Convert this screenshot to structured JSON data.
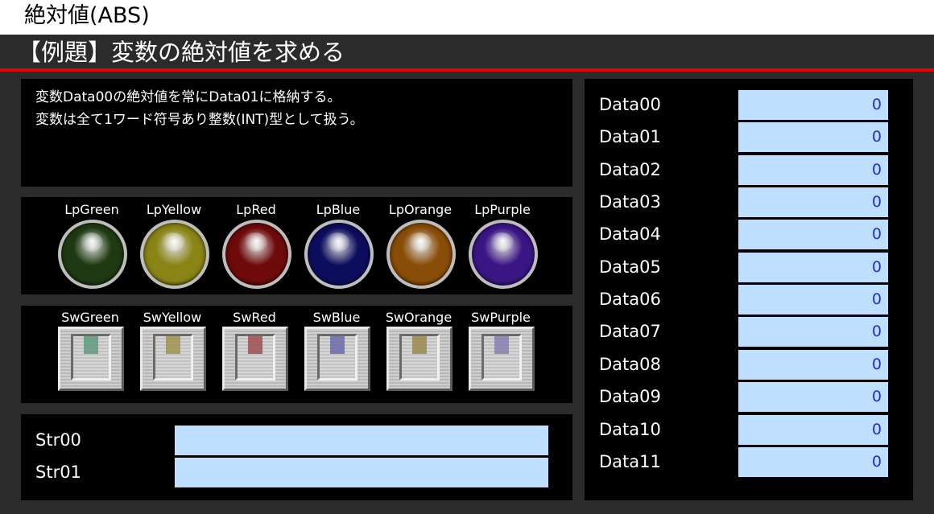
{
  "window": {
    "title": "絶対値(ABS)"
  },
  "header": {
    "subtitle": "【例題】変数の絶対値を求める",
    "accent_color": "#e60000"
  },
  "description": {
    "lines": [
      "変数Data00の絶対値を常にData01に格納する。",
      "変数は全て1ワード符号あり整数(INT)型として扱う。"
    ]
  },
  "lamps": [
    {
      "label": "LpGreen",
      "color": "#1e3a12"
    },
    {
      "label": "LpYellow",
      "color": "#8a8416"
    },
    {
      "label": "LpRed",
      "color": "#6e0a0a"
    },
    {
      "label": "LpBlue",
      "color": "#0d0d5e"
    },
    {
      "label": "LpOrange",
      "color": "#8a4d08"
    },
    {
      "label": "LpPurple",
      "color": "#3a1684"
    }
  ],
  "switches": [
    {
      "label": "SwGreen",
      "color": "#5f9a7f"
    },
    {
      "label": "SwYellow",
      "color": "#9e9450"
    },
    {
      "label": "SwRed",
      "color": "#a05050"
    },
    {
      "label": "SwBlue",
      "color": "#6c6aa8"
    },
    {
      "label": "SwOrange",
      "color": "#9e8a50"
    },
    {
      "label": "SwPurple",
      "color": "#8a80b0"
    }
  ],
  "strings": [
    {
      "label": "Str00",
      "value": ""
    },
    {
      "label": "Str01",
      "value": ""
    }
  ],
  "data": [
    {
      "label": "Data00",
      "value": "0"
    },
    {
      "label": "Data01",
      "value": "0"
    },
    {
      "label": "Data02",
      "value": "0"
    },
    {
      "label": "Data03",
      "value": "0"
    },
    {
      "label": "Data04",
      "value": "0"
    },
    {
      "label": "Data05",
      "value": "0"
    },
    {
      "label": "Data06",
      "value": "0"
    },
    {
      "label": "Data07",
      "value": "0"
    },
    {
      "label": "Data08",
      "value": "0"
    },
    {
      "label": "Data09",
      "value": "0"
    },
    {
      "label": "Data10",
      "value": "0"
    },
    {
      "label": "Data11",
      "value": "0"
    }
  ]
}
